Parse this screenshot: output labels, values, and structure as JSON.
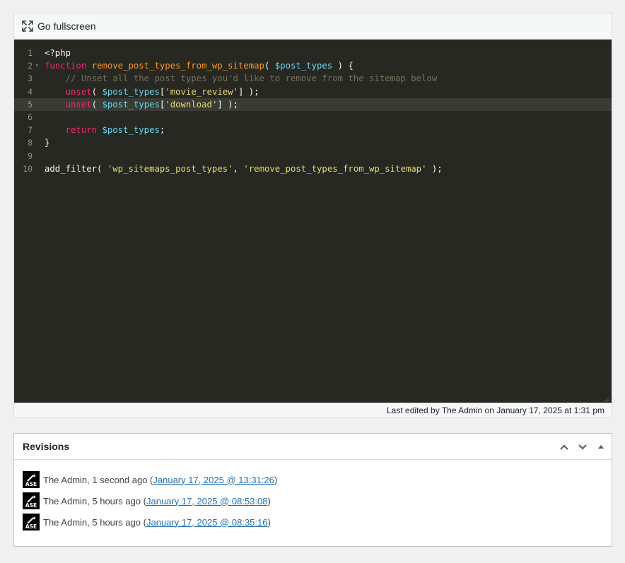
{
  "toolbar": {
    "fullscreen_label": "Go fullscreen",
    "fullscreen_icon": "fullscreen-icon"
  },
  "code": {
    "language": "php",
    "active_line": 5,
    "lines": [
      {
        "n": "1",
        "fold": false,
        "tokens": [
          {
            "t": "<?php",
            "c": "#f8f8f2"
          }
        ]
      },
      {
        "n": "2",
        "fold": true,
        "tokens": [
          {
            "t": "function",
            "c": "#f92672"
          },
          {
            "t": " ",
            "c": "#f8f8f2"
          },
          {
            "t": "remove_post_types_from_wp_sitemap",
            "c": "#fd971f"
          },
          {
            "t": "( ",
            "c": "#f8f8f2"
          },
          {
            "t": "$post_types",
            "c": "#66d9ef"
          },
          {
            "t": " ) {",
            "c": "#f8f8f2"
          }
        ]
      },
      {
        "n": "3",
        "fold": false,
        "tokens": [
          {
            "t": "    // Unset all the post types you'd like to remove from the sitemap below",
            "c": "#75715e"
          }
        ]
      },
      {
        "n": "4",
        "fold": false,
        "tokens": [
          {
            "t": "    ",
            "c": "#f8f8f2"
          },
          {
            "t": "unset",
            "c": "#f92672"
          },
          {
            "t": "( ",
            "c": "#f8f8f2"
          },
          {
            "t": "$post_types",
            "c": "#66d9ef"
          },
          {
            "t": "[",
            "c": "#f8f8f2"
          },
          {
            "t": "'movie_review'",
            "c": "#e6db74"
          },
          {
            "t": "] );",
            "c": "#f8f8f2"
          }
        ]
      },
      {
        "n": "5",
        "fold": false,
        "tokens": [
          {
            "t": "    ",
            "c": "#f8f8f2"
          },
          {
            "t": "unset",
            "c": "#f92672"
          },
          {
            "t": "( ",
            "c": "#f8f8f2"
          },
          {
            "t": "$post_types",
            "c": "#66d9ef"
          },
          {
            "t": "[",
            "c": "#f8f8f2"
          },
          {
            "t": "'download'",
            "c": "#e6db74"
          },
          {
            "t": "] );",
            "c": "#f8f8f2"
          }
        ]
      },
      {
        "n": "6",
        "fold": false,
        "tokens": []
      },
      {
        "n": "7",
        "fold": false,
        "tokens": [
          {
            "t": "    ",
            "c": "#f8f8f2"
          },
          {
            "t": "return",
            "c": "#f92672"
          },
          {
            "t": " ",
            "c": "#f8f8f2"
          },
          {
            "t": "$post_types",
            "c": "#66d9ef"
          },
          {
            "t": ";",
            "c": "#f8f8f2"
          }
        ]
      },
      {
        "n": "8",
        "fold": false,
        "tokens": [
          {
            "t": "}",
            "c": "#f8f8f2"
          }
        ]
      },
      {
        "n": "9",
        "fold": false,
        "tokens": []
      },
      {
        "n": "10",
        "fold": false,
        "tokens": [
          {
            "t": "add_filter",
            "c": "#f8f8f2"
          },
          {
            "t": "( ",
            "c": "#f8f8f2"
          },
          {
            "t": "'wp_sitemaps_post_types'",
            "c": "#e6db74"
          },
          {
            "t": ", ",
            "c": "#f8f8f2"
          },
          {
            "t": "'remove_post_types_from_wp_sitemap'",
            "c": "#e6db74"
          },
          {
            "t": " );",
            "c": "#f8f8f2"
          }
        ]
      }
    ]
  },
  "status": {
    "last_edited": "Last edited by The Admin on January 17, 2025 at 1:31 pm"
  },
  "revisions": {
    "title": "Revisions",
    "items": [
      {
        "author_text": "The Admin, 1 second ago (",
        "link": "January 17, 2025 @ 13:31:26",
        "close": ")"
      },
      {
        "author_text": "The Admin, 5 hours ago (",
        "link": "January 17, 2025 @ 08:53:08",
        "close": ")"
      },
      {
        "author_text": "The Admin, 5 hours ago (",
        "link": "January 17, 2025 @ 08:35:16",
        "close": ")"
      }
    ],
    "avatar_label": "ASE"
  },
  "colors": {
    "editor_bg": "#272822",
    "link": "#2271b1",
    "page_bg": "#f0f0f1"
  }
}
